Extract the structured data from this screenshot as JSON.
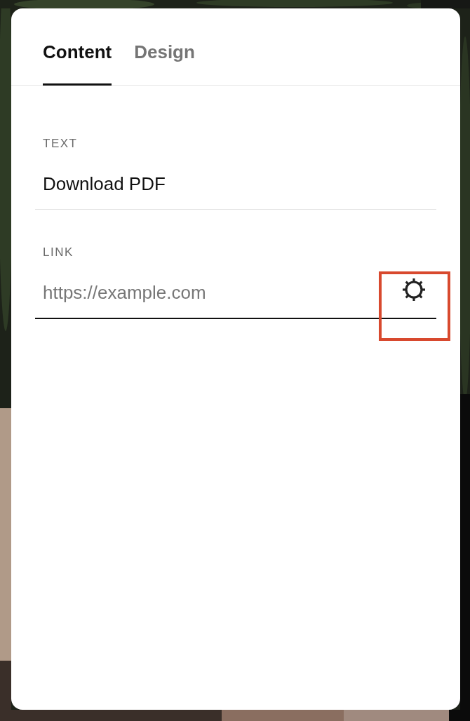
{
  "tabs": [
    {
      "label": "Content",
      "selected": true
    },
    {
      "label": "Design",
      "selected": false
    }
  ],
  "fields": [
    {
      "kind": "text",
      "label": "TEXT",
      "value": "Download PDF",
      "focused": false
    },
    {
      "kind": "link",
      "label": "LINK",
      "placeholder": "https://example.com",
      "focused": true,
      "settings_highlighted": true
    }
  ]
}
